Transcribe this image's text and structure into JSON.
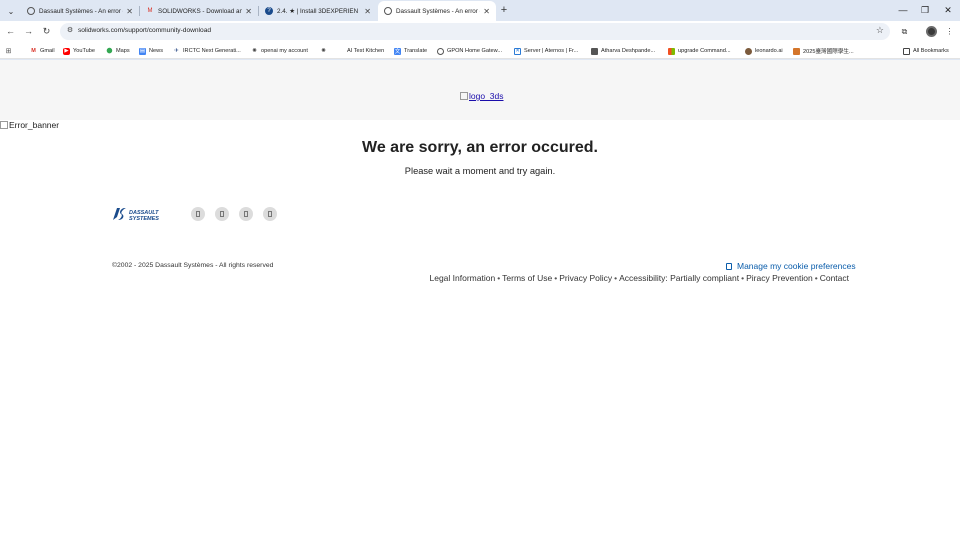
{
  "browser": {
    "tabs": [
      {
        "title": "Dassault Systèmes - An error o",
        "active": false
      },
      {
        "title": "SOLIDWORKS - Download and",
        "active": false
      },
      {
        "title": "2.4. ★ | Install 3DEXPERIEN",
        "active": false
      },
      {
        "title": "Dassault Systèmes - An error o",
        "active": true
      }
    ],
    "url": "solidworks.com/support/community-download",
    "bookmarks": [
      {
        "label": "Gmail",
        "icon": "gmail-icon",
        "color": "#d93025"
      },
      {
        "label": "YouTube",
        "icon": "youtube-icon",
        "color": "#ff0000"
      },
      {
        "label": "Maps",
        "icon": "maps-icon",
        "color": "#34a853"
      },
      {
        "label": "News",
        "icon": "news-icon",
        "color": "#4285f4"
      },
      {
        "label": "IRCTC Next Generati...",
        "icon": "irctc-icon",
        "color": "#1a3d7c"
      },
      {
        "label": "openai my account",
        "icon": "openai-icon",
        "color": "#444444"
      },
      {
        "label": "",
        "icon": "openai-icon",
        "color": "#444444"
      },
      {
        "label": "AI Test Kitchen",
        "icon": "blank-icon",
        "color": "#ffffff"
      },
      {
        "label": "Translate",
        "icon": "translate-icon",
        "color": "#4285f4"
      },
      {
        "label": "GPON Home Gatew...",
        "icon": "globe-icon",
        "color": "#555555"
      },
      {
        "label": "Server | Aternos | Fr...",
        "icon": "aternos-icon",
        "color": "#2b7bd6"
      },
      {
        "label": "Atharva Deshpande...",
        "icon": "person-icon",
        "color": "#444444"
      },
      {
        "label": "upgrade Command...",
        "icon": "windows-icon",
        "color": "#f25022"
      },
      {
        "label": "leonardo.ai",
        "icon": "leonardo-icon",
        "color": "#7b5a3c"
      },
      {
        "label": "2025臺灣國際學生...",
        "icon": "flag-icon",
        "color": "#d4752a"
      }
    ],
    "all_bookmarks_label": "All Bookmarks"
  },
  "page": {
    "logo_alt": "logo_3ds",
    "banner_alt": "Error_banner",
    "error_title": "We are sorry, an error occured.",
    "error_subtitle": "Please wait a moment and try again.",
    "copyright": "©2002 - 2025 Dassault Systèmes - All rights reserved",
    "cookie_link": "Manage my cookie preferences",
    "legal_links": [
      "Legal Information",
      "Terms of Use",
      "Privacy Policy",
      "Accessibility: Partially compliant",
      "Piracy Prevention",
      "Contact"
    ],
    "separator": "•"
  },
  "colors": {
    "chrome_bg": "#dfe7f3",
    "link_blue": "#0a5dab",
    "logo_blue": "#1a4b8c"
  }
}
